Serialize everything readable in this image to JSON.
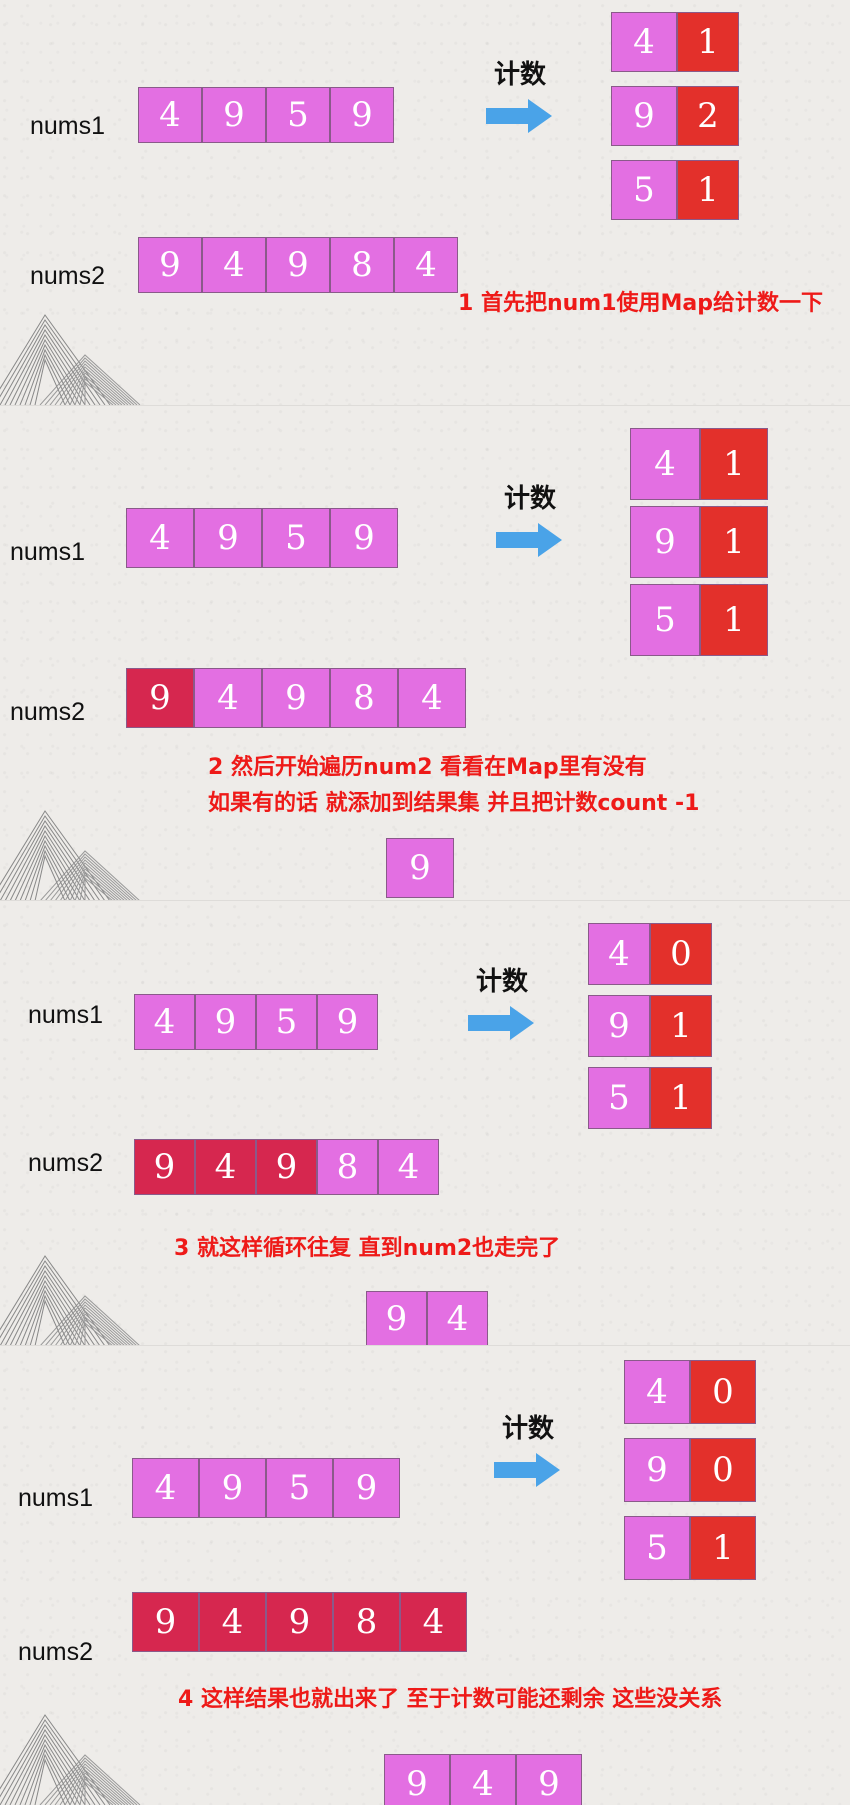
{
  "labels": {
    "nums1": "nums1",
    "nums2": "nums2",
    "arrow": "计数"
  },
  "colors": {
    "pink": "#e36fe2",
    "highlight_red": "#d6274f",
    "count_red": "#e3302b",
    "note_red": "#ee1a18",
    "arrow_blue": "#4aa3e8"
  },
  "steps": [
    {
      "nums1": [
        "4",
        "9",
        "5",
        "9"
      ],
      "nums2": [
        "9",
        "4",
        "9",
        "8",
        "4"
      ],
      "nums2_highlighted": 0,
      "map": [
        {
          "key": "4",
          "count": "1"
        },
        {
          "key": "9",
          "count": "2"
        },
        {
          "key": "5",
          "count": "1"
        }
      ],
      "note": [
        "1 首先把num1使用Map给计数一下"
      ],
      "result": []
    },
    {
      "nums1": [
        "4",
        "9",
        "5",
        "9"
      ],
      "nums2": [
        "9",
        "4",
        "9",
        "8",
        "4"
      ],
      "nums2_highlighted": 1,
      "map": [
        {
          "key": "4",
          "count": "1"
        },
        {
          "key": "9",
          "count": "1"
        },
        {
          "key": "5",
          "count": "1"
        }
      ],
      "note": [
        "2 然后开始遍历num2 看看在Map里有没有",
        "如果有的话 就添加到结果集 并且把计数count -1"
      ],
      "result": [
        "9"
      ]
    },
    {
      "nums1": [
        "4",
        "9",
        "5",
        "9"
      ],
      "nums2": [
        "9",
        "4",
        "9",
        "8",
        "4"
      ],
      "nums2_highlighted": 3,
      "map": [
        {
          "key": "4",
          "count": "0"
        },
        {
          "key": "9",
          "count": "1"
        },
        {
          "key": "5",
          "count": "1"
        }
      ],
      "note": [
        "3 就这样循环往复 直到num2也走完了"
      ],
      "result": [
        "9",
        "4"
      ]
    },
    {
      "nums1": [
        "4",
        "9",
        "5",
        "9"
      ],
      "nums2": [
        "9",
        "4",
        "9",
        "8",
        "4"
      ],
      "nums2_highlighted": 5,
      "map": [
        {
          "key": "4",
          "count": "0"
        },
        {
          "key": "9",
          "count": "0"
        },
        {
          "key": "5",
          "count": "1"
        }
      ],
      "note": [
        "4 这样结果也就出来了 至于计数可能还剩余 这些没关系"
      ],
      "result": [
        "9",
        "4",
        "9"
      ]
    }
  ]
}
